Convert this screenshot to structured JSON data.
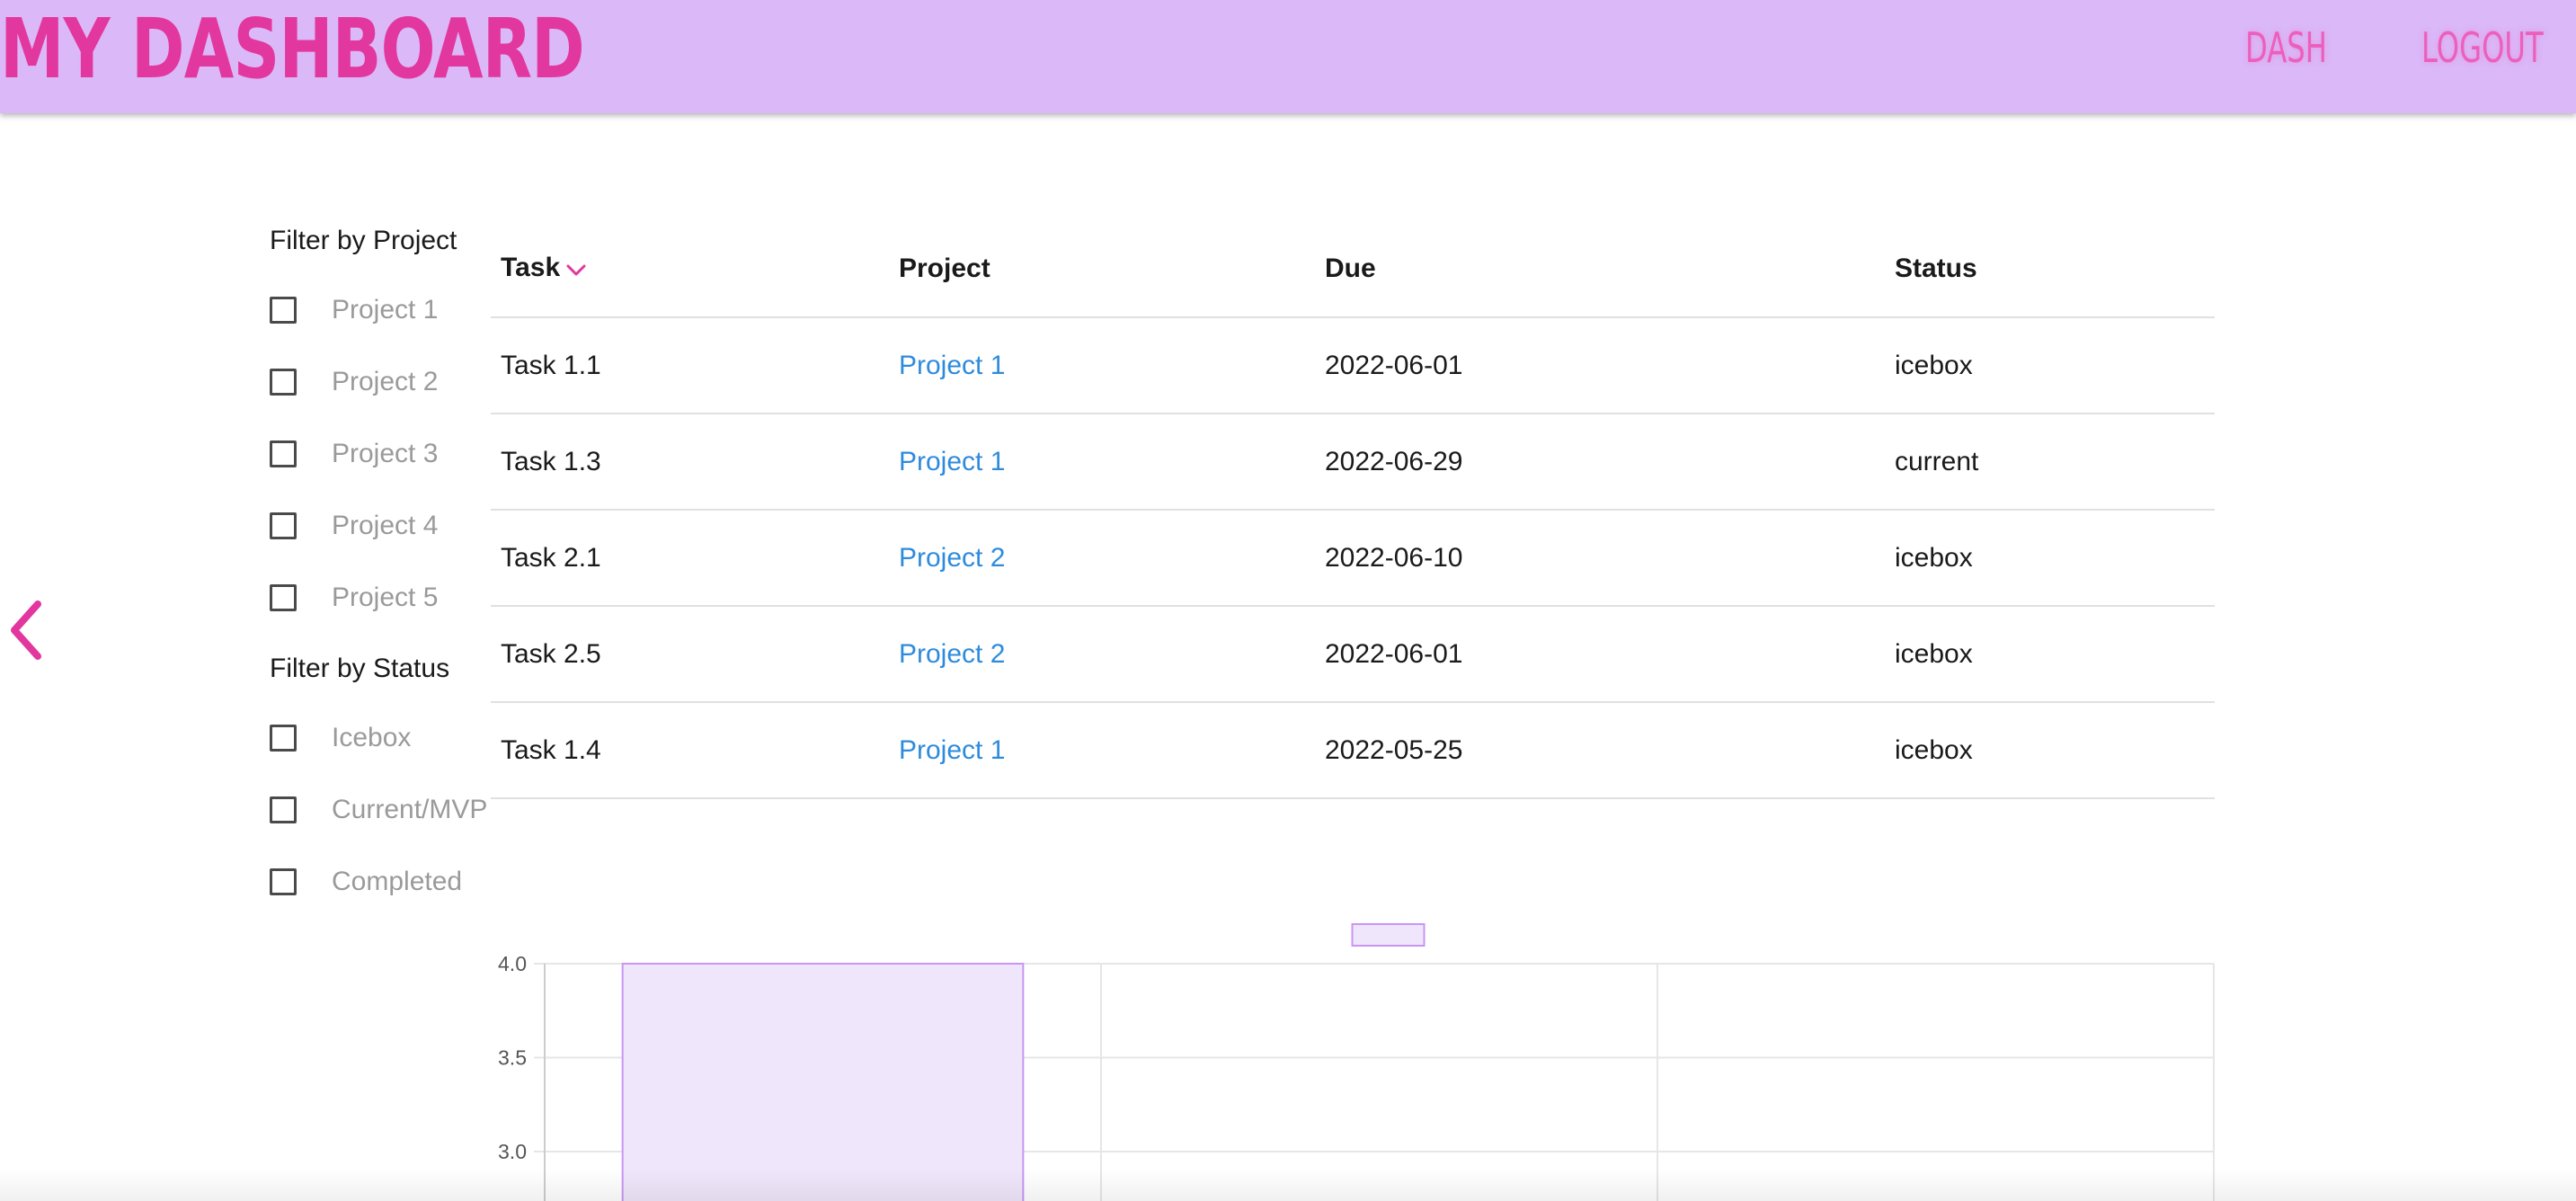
{
  "header": {
    "title": "MY DASHBOARD",
    "nav": {
      "dash_label": "DASH",
      "logout_label": "LOGOUT"
    }
  },
  "colors": {
    "header_background": "#dbb8f8",
    "brand_pink": "#e2379e",
    "nav_pink": "#ec5fbd",
    "link_blue": "#2e8bdc",
    "bar_fill": "#f0e6fb",
    "bar_border": "#c995f5"
  },
  "icons": {
    "back": "chevron-left-icon",
    "sort": "chevron-down-icon",
    "checkbox": "checkbox-unchecked"
  },
  "filters": {
    "project_heading": "Filter by Project",
    "projects": [
      "Project 1",
      "Project 2",
      "Project 3",
      "Project 4",
      "Project 5"
    ],
    "status_heading": "Filter by Status",
    "statuses": [
      "Icebox",
      "Current/MVP",
      "Completed"
    ]
  },
  "table": {
    "headers": {
      "task": "Task",
      "project": "Project",
      "due": "Due",
      "status": "Status"
    },
    "sort_column": "Task",
    "sort_direction": "descending",
    "rows": [
      {
        "task": "Task 1.1",
        "project": "Project 1",
        "due": "2022-06-01",
        "status": "icebox"
      },
      {
        "task": "Task 1.3",
        "project": "Project 1",
        "due": "2022-06-29",
        "status": "current"
      },
      {
        "task": "Task 2.1",
        "project": "Project 2",
        "due": "2022-06-10",
        "status": "icebox"
      },
      {
        "task": "Task 2.5",
        "project": "Project 2",
        "due": "2022-06-01",
        "status": "icebox"
      },
      {
        "task": "Task 1.4",
        "project": "Project 1",
        "due": "2022-05-25",
        "status": "icebox"
      }
    ]
  },
  "chart_data": {
    "type": "bar",
    "title": "",
    "xlabel": "",
    "ylabel": "",
    "categories": [
      "",
      "",
      ""
    ],
    "values": [
      4,
      null,
      null
    ],
    "visible_ylim": [
      2.8,
      4.0
    ],
    "y_ticks": [
      "4.0",
      "3.5",
      "3.0"
    ],
    "grid": true,
    "legend": {
      "position": "top-center",
      "entries": [
        ""
      ]
    }
  }
}
